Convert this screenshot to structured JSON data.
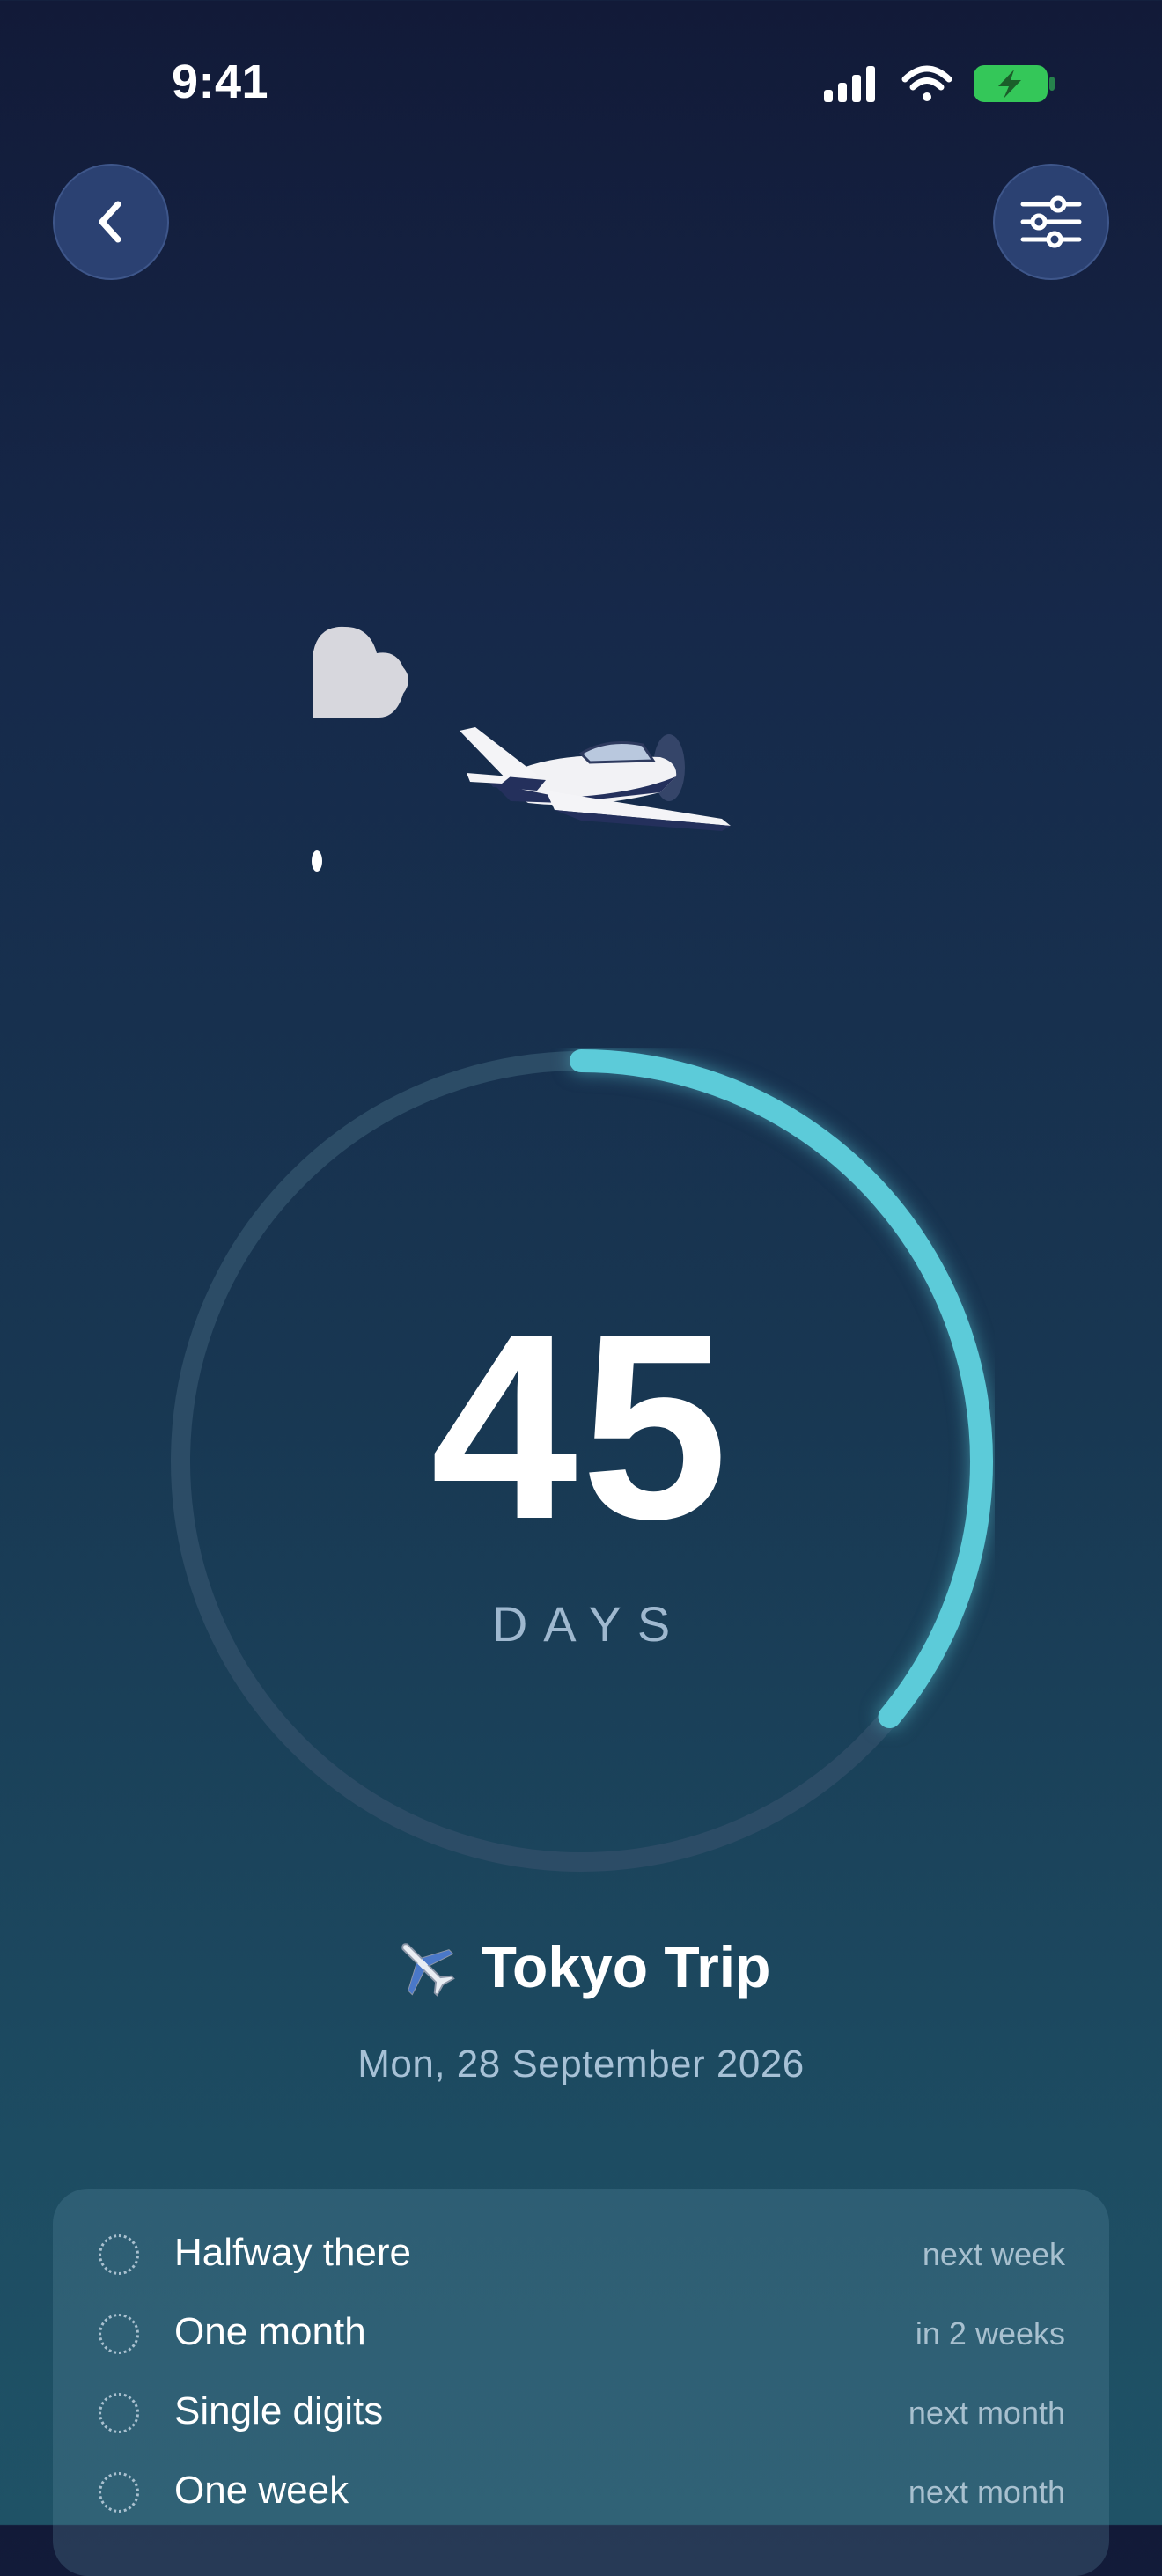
{
  "status_bar": {
    "time": "9:41",
    "icons": [
      "cellular-signal-icon",
      "wifi-icon",
      "battery-charging-icon"
    ]
  },
  "header": {
    "back_icon": "chevron-left-icon",
    "settings_icon": "sliders-icon"
  },
  "countdown": {
    "value": "45",
    "unit": "DAYS",
    "progress": 0.36
  },
  "event": {
    "emoji": "airplane-icon",
    "title": "Tokyo Trip",
    "date": "Mon, 28 September 2026"
  },
  "milestones": [
    {
      "label": "Halfway there",
      "when": "next week"
    },
    {
      "label": "One month",
      "when": "in 2 weeks"
    },
    {
      "label": "Single digits",
      "when": "next month"
    },
    {
      "label": "One week",
      "when": "next month"
    }
  ],
  "colors": {
    "accent": "#5ccbd9",
    "track": "#2c4c66",
    "button_bg": "#2b4172",
    "battery": "#34c759"
  }
}
